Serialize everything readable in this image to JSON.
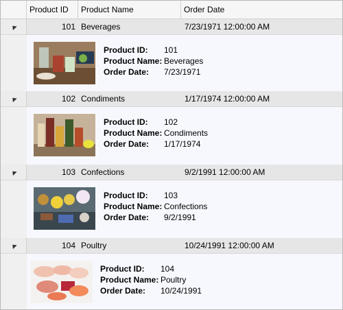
{
  "columns": {
    "indicator": "",
    "product_id": "Product ID",
    "product_name": "Product Name",
    "order_date": "Order Date"
  },
  "detail_labels": {
    "product_id": "Product ID:",
    "product_name": "Product Name:",
    "order_date": "Order Date:"
  },
  "rows": [
    {
      "id": "101",
      "name": "Beverages",
      "order_date": "7/23/1971 12:00:00 AM",
      "detail_id": "101",
      "detail_name": "Beverages",
      "detail_date": "7/23/1971",
      "image": "beverages-photo"
    },
    {
      "id": "102",
      "name": "Condiments",
      "order_date": "1/17/1974 12:00:00 AM",
      "detail_id": "102",
      "detail_name": "Condiments",
      "detail_date": "1/17/1974",
      "image": "condiments-photo"
    },
    {
      "id": "103",
      "name": "Confections",
      "order_date": "9/2/1991 12:00:00 AM",
      "detail_id": "103",
      "detail_name": "Confections",
      "detail_date": "9/2/1991",
      "image": "confections-photo"
    },
    {
      "id": "104",
      "name": "Poultry",
      "order_date": "10/24/1991 12:00:00 AM",
      "detail_id": "104",
      "detail_name": "Poultry",
      "detail_date": "10/24/1991",
      "image": "poultry-photo"
    }
  ]
}
